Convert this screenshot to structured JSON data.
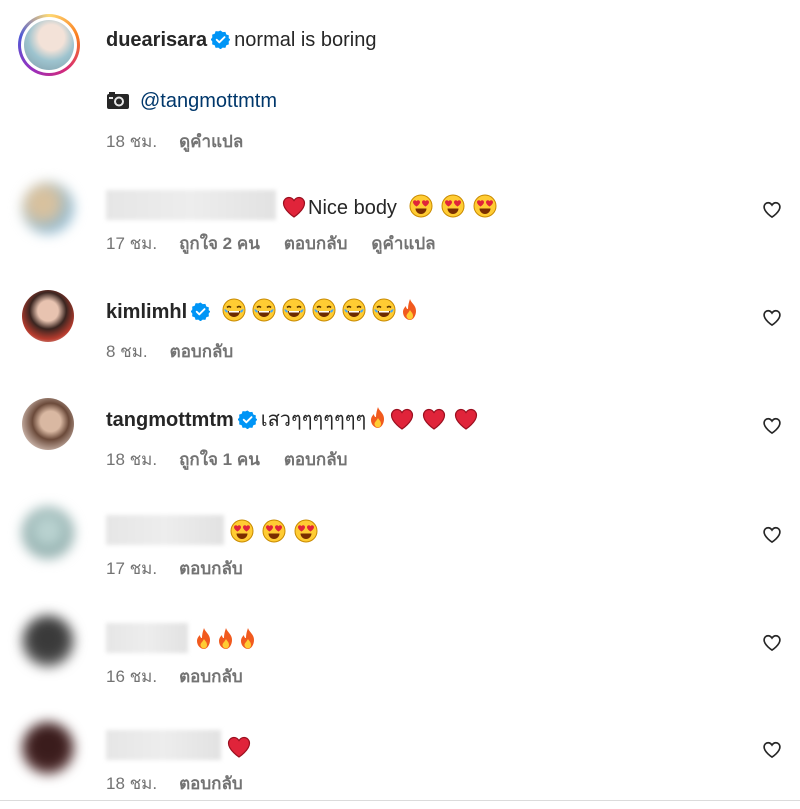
{
  "caption": {
    "username": "duearisara",
    "text": "normal is boring",
    "mention": "@tangmottmtm",
    "time": "18 ชม.",
    "translate": "ดูคำแปล"
  },
  "comments": [
    {
      "username": "",
      "text": "Nice body",
      "time": "17 ชม.",
      "likes": "ถูกใจ 2 คน",
      "reply": "ตอบกลับ",
      "translate": "ดูคำแปล"
    },
    {
      "username": "kimlimhl",
      "time": "8 ชม.",
      "reply": "ตอบกลับ"
    },
    {
      "username": "tangmottmtm",
      "text": "เสวๆๆๆๆๆๆๆ",
      "time": "18 ชม.",
      "likes": "ถูกใจ 1 คน",
      "reply": "ตอบกลับ"
    },
    {
      "username": "",
      "time": "17 ชม.",
      "reply": "ตอบกลับ"
    },
    {
      "username": "",
      "time": "16 ชม.",
      "reply": "ตอบกลับ"
    },
    {
      "username": "",
      "time": "18 ชม.",
      "reply": "ตอบกลับ"
    }
  ],
  "icons": {
    "verified": "verified-badge-icon",
    "camera": "camera-icon",
    "like": "heart-outline-icon",
    "heart_emoji": "red-heart-emoji",
    "heart_eyes": "heart-eyes-emoji",
    "laugh": "tears-of-joy-emoji",
    "fire": "fire-emoji"
  },
  "colors": {
    "text": "#262626",
    "muted": "#737373",
    "mention": "#00376b",
    "verified": "#0095f6"
  }
}
